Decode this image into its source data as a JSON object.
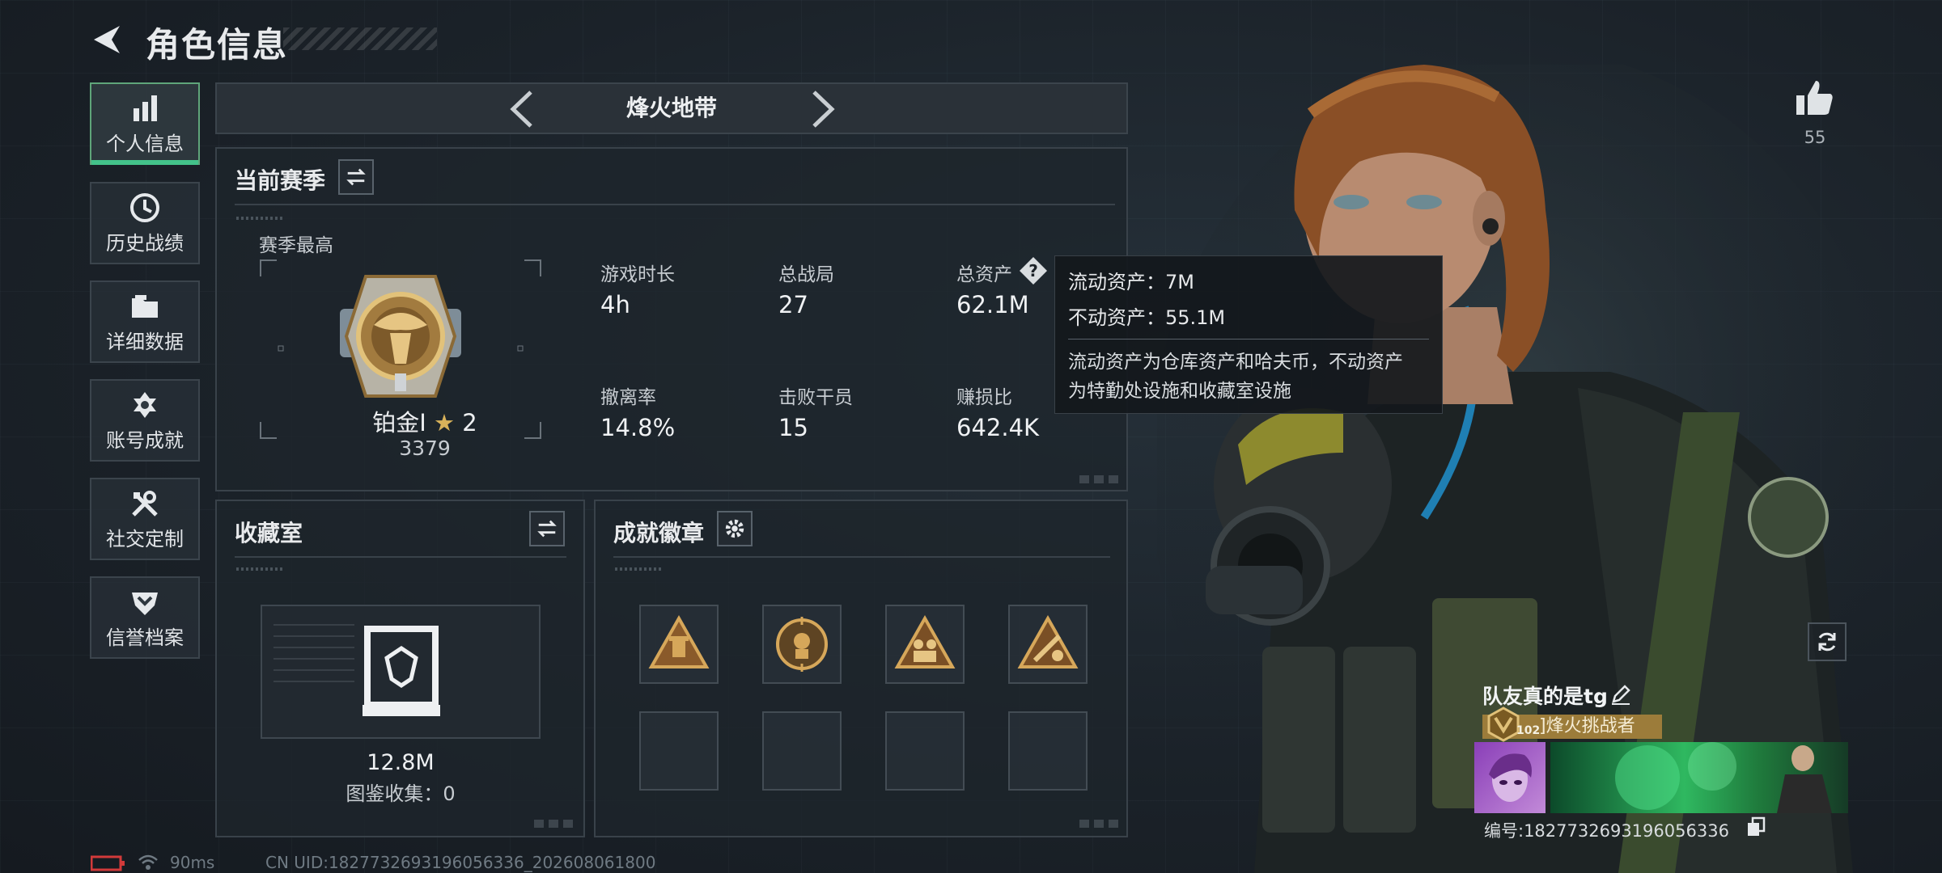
{
  "header": {
    "title": "角色信息"
  },
  "sidebar": {
    "items": [
      {
        "label": "个人信息",
        "active": true,
        "icon": "bar-chart-icon"
      },
      {
        "label": "历史战绩",
        "active": false,
        "icon": "clock-icon"
      },
      {
        "label": "详细数据",
        "active": false,
        "icon": "folder-icon"
      },
      {
        "label": "账号成就",
        "active": false,
        "icon": "achievement-icon"
      },
      {
        "label": "社交定制",
        "active": false,
        "icon": "tools-icon"
      },
      {
        "label": "信誉档案",
        "active": false,
        "icon": "shield-icon"
      }
    ]
  },
  "mode": {
    "title": "烽火地带"
  },
  "season": {
    "title": "当前赛季",
    "best_label": "赛季最高",
    "rank_name": "铂金Ⅰ",
    "rank_stars": "2",
    "rank_score": "3379",
    "stats": [
      {
        "label": "游戏时长",
        "value": "4h"
      },
      {
        "label": "总战局",
        "value": "27"
      },
      {
        "label": "总资产",
        "value": "62.1M"
      },
      {
        "label": "撤离率",
        "value": "14.8%"
      },
      {
        "label": "击败干员",
        "value": "15"
      },
      {
        "label": "赚损比",
        "value": "642.4K"
      }
    ]
  },
  "tooltip": {
    "liquid": "流动资产：7M",
    "fixed": "不动资产：55.1M",
    "desc_line1": "流动资产为仓库资产和哈夫币，不动资产",
    "desc_line2": "为特勤处设施和收藏室设施"
  },
  "collection": {
    "title": "收藏室",
    "value": "12.8M",
    "catalog": "图鉴收集：0"
  },
  "achievements": {
    "title": "成就徽章",
    "badges": [
      "badge-1",
      "badge-2",
      "badge-3",
      "badge-4"
    ],
    "empty_slots": 4
  },
  "likes": {
    "count": "55"
  },
  "player": {
    "name": "队友真的是tg",
    "level": "102",
    "title": "]烽火挑战者",
    "id_label": "编号:1827732693196056336⁡"
  },
  "status": {
    "ping": "90ms",
    "uid": "CN UID:1827732693196056336⁢_202608061800"
  },
  "colors": {
    "accent": "#43c28a",
    "gold": "#c9a24a",
    "battery": "#d23a3a"
  }
}
